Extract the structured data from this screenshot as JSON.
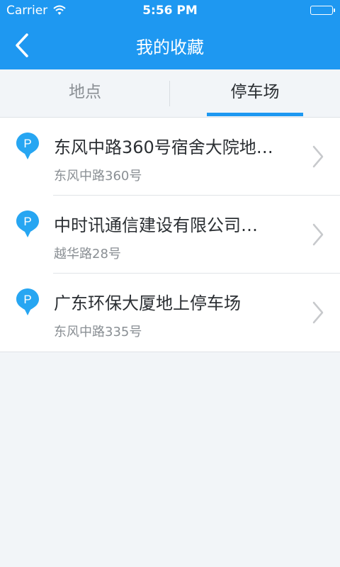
{
  "status_bar": {
    "carrier": "Carrier",
    "time": "5:56 PM"
  },
  "nav": {
    "title": "我的收藏",
    "back_icon": "chevron-left-icon"
  },
  "tabs": [
    {
      "label": "地点",
      "active": false
    },
    {
      "label": "停车场",
      "active": true
    }
  ],
  "colors": {
    "accent": "#1e98f1",
    "pin": "#27a6f2",
    "background": "#f2f5f8"
  },
  "favorites": [
    {
      "name": "东风中路360号宿舍大院地…",
      "address": "东风中路360号",
      "icon": "parking-pin-icon"
    },
    {
      "name": "中时讯通信建设有限公司…",
      "address": "越华路28号",
      "icon": "parking-pin-icon"
    },
    {
      "name": "广东环保大厦地上停车场",
      "address": "东风中路335号",
      "icon": "parking-pin-icon"
    }
  ]
}
